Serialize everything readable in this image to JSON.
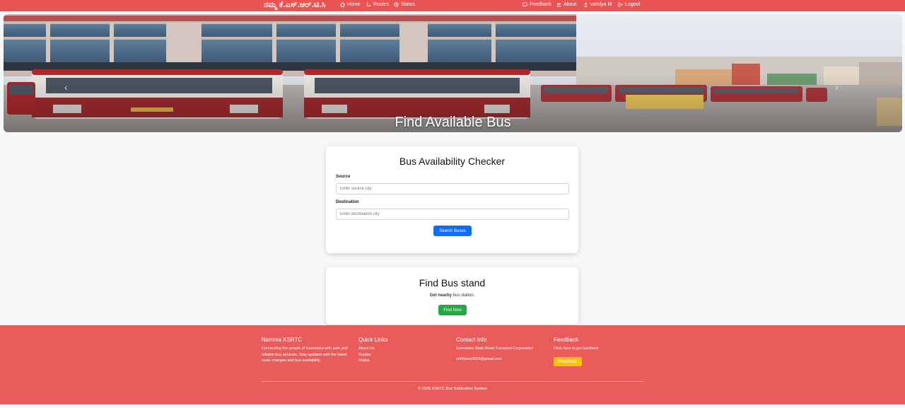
{
  "navbar": {
    "brand": "ನಮ್ಮ ಕೆ.ಎಸ್.ಆರ್.ಟಿ.ಸಿ",
    "left_items": [
      {
        "label": "Home",
        "icon": "home-icon"
      },
      {
        "label": "Routes",
        "icon": "routes-icon"
      },
      {
        "label": "Status",
        "icon": "status-icon"
      }
    ],
    "right_items": [
      {
        "label": "Feedback",
        "icon": "feedback-icon"
      },
      {
        "label": "About",
        "icon": "about-icon"
      },
      {
        "label": "vandya M",
        "icon": "user-icon"
      },
      {
        "label": "Logout",
        "icon": "logout-icon"
      }
    ],
    "color": "#ea5455"
  },
  "hero": {
    "title": "Find Available Bus"
  },
  "checker": {
    "title": "Bus Availability Checker",
    "source_label": "Source",
    "source_placeholder": "Enter source city",
    "destination_label": "Destination",
    "destination_placeholder": "Enter destination city",
    "search_button": "Search Buses"
  },
  "busstand": {
    "title": "Find Bus stand",
    "subtitle_bold": "Get nearby",
    "subtitle_rest": " bus station.",
    "button": "Find Now"
  },
  "footer": {
    "col1": {
      "heading": "Namma KSRTC",
      "text": "Connecting the people of Karnataka with safe and reliable bus services. Stay updated with the latest route changes and bus availability."
    },
    "col2": {
      "heading": "Quick Links",
      "links": [
        "About Us",
        "Routes",
        "Status"
      ]
    },
    "col3": {
      "heading": "Contact Info",
      "line1": "Karnataka State Road Transport Corporation",
      "line2": "notifybus2024@gmail.com"
    },
    "col4": {
      "heading": "Feedback",
      "text": "Click here to get feedback",
      "button": "Feedback"
    },
    "copyright": "© 2026 KSRTC Bus Notification System"
  },
  "colors": {
    "accent": "#ea5455",
    "primary_button": "#0d6efd",
    "success_button": "#28a745",
    "warning_button": "#ffc107"
  }
}
